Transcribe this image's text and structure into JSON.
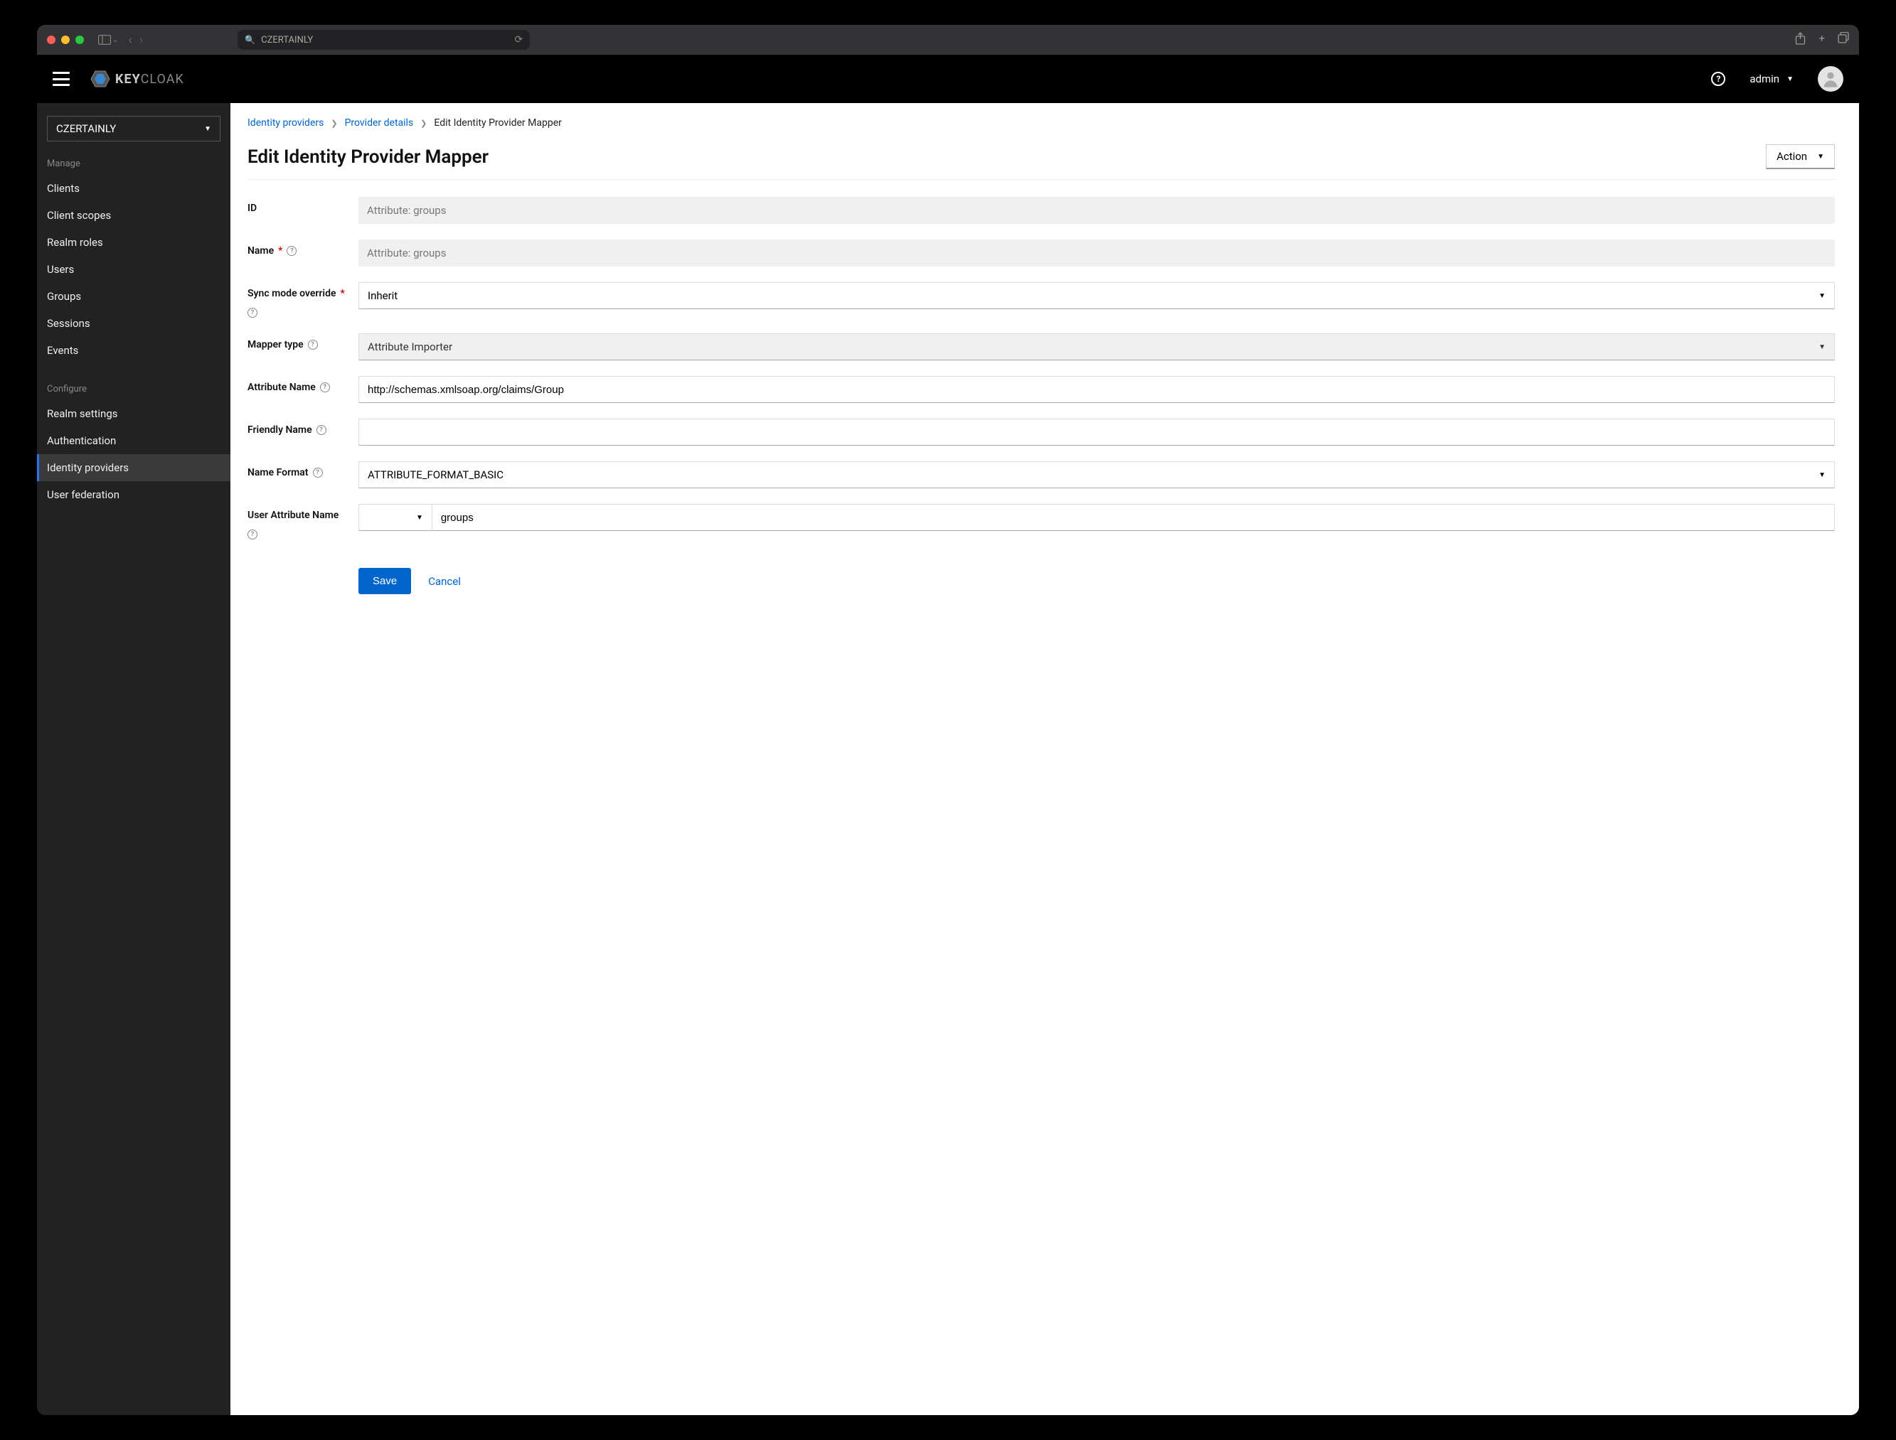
{
  "browser": {
    "url_display": "CZERTAINLY"
  },
  "header": {
    "logo_bold": "KEY",
    "logo_light": "CLOAK",
    "user": "admin"
  },
  "sidebar": {
    "realm": "CZERTAINLY",
    "sections": {
      "manage_label": "Manage",
      "configure_label": "Configure"
    },
    "manage_items": [
      "Clients",
      "Client scopes",
      "Realm roles",
      "Users",
      "Groups",
      "Sessions",
      "Events"
    ],
    "configure_items": [
      "Realm settings",
      "Authentication",
      "Identity providers",
      "User federation"
    ]
  },
  "breadcrumb": {
    "item1": "Identity providers",
    "item2": "Provider details",
    "item3": "Edit Identity Provider Mapper"
  },
  "page": {
    "title": "Edit Identity Provider Mapper",
    "action_label": "Action"
  },
  "form": {
    "id_label": "ID",
    "id_value": "Attribute: groups",
    "name_label": "Name",
    "name_value": "Attribute: groups",
    "sync_label": "Sync mode override",
    "sync_value": "Inherit",
    "mapper_type_label": "Mapper type",
    "mapper_type_value": "Attribute Importer",
    "attr_name_label": "Attribute Name",
    "attr_name_value": "http://schemas.xmlsoap.org/claims/Group",
    "friendly_label": "Friendly Name",
    "friendly_value": "",
    "name_format_label": "Name Format",
    "name_format_value": "ATTRIBUTE_FORMAT_BASIC",
    "user_attr_label": "User Attribute Name",
    "user_attr_value": "groups",
    "save": "Save",
    "cancel": "Cancel"
  }
}
